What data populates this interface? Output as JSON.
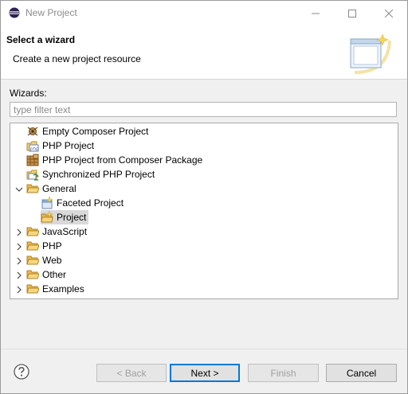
{
  "window": {
    "title": "New Project"
  },
  "header": {
    "title": "Select a wizard",
    "description": "Create a new project resource"
  },
  "wizards": {
    "label": "Wizards:",
    "filter_placeholder": "type filter text",
    "items": [
      {
        "label": "Empty Composer Project",
        "icon": "composer-icon"
      },
      {
        "label": "PHP Project",
        "icon": "php-project-icon"
      },
      {
        "label": "PHP Project from Composer Package",
        "icon": "composer-package-icon"
      },
      {
        "label": "Synchronized PHP Project",
        "icon": "sync-project-icon"
      },
      {
        "label": "General",
        "icon": "folder-open-icon",
        "expanded": true
      },
      {
        "label": "Faceted Project",
        "icon": "faceted-project-icon"
      },
      {
        "label": "Project",
        "icon": "project-icon",
        "selected": true
      },
      {
        "label": "JavaScript",
        "icon": "folder-icon",
        "expanded": false
      },
      {
        "label": "PHP",
        "icon": "folder-icon",
        "expanded": false
      },
      {
        "label": "Web",
        "icon": "folder-icon",
        "expanded": false
      },
      {
        "label": "Other",
        "icon": "folder-icon",
        "expanded": false
      },
      {
        "label": "Examples",
        "icon": "folder-icon",
        "expanded": false
      }
    ]
  },
  "buttons": {
    "back": "< Back",
    "next": "Next >",
    "finish": "Finish",
    "cancel": "Cancel"
  },
  "colors": {
    "selection": "#d9d9d9",
    "default_button_border": "#0078d7",
    "folder": "#e8b84a"
  }
}
